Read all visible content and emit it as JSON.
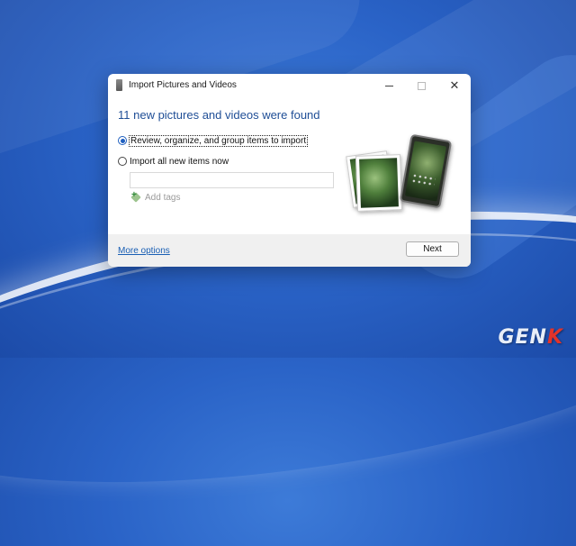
{
  "dialog": {
    "title": "Import Pictures and Videos",
    "heading": "11 new pictures and videos were found",
    "options": [
      {
        "label": "Review, organize, and group items to import",
        "selected": true
      },
      {
        "label": "Import all new items now",
        "selected": false
      }
    ],
    "tags_input_value": "",
    "add_tags_label": "Add tags",
    "more_options_label": "More options",
    "next_label": "Next",
    "window_controls": {
      "minimize_icon": "minimize-icon",
      "maximize_icon": "maximize-icon",
      "close_icon": "close-icon",
      "close_glyph": "✕"
    }
  },
  "watermark": {
    "text_main": "GEN",
    "text_accent": "K"
  },
  "colors": {
    "heading": "#1f4e96",
    "link": "#1a5fb4",
    "accent": "#1f5fbf",
    "watermark_accent": "#e2332a"
  }
}
